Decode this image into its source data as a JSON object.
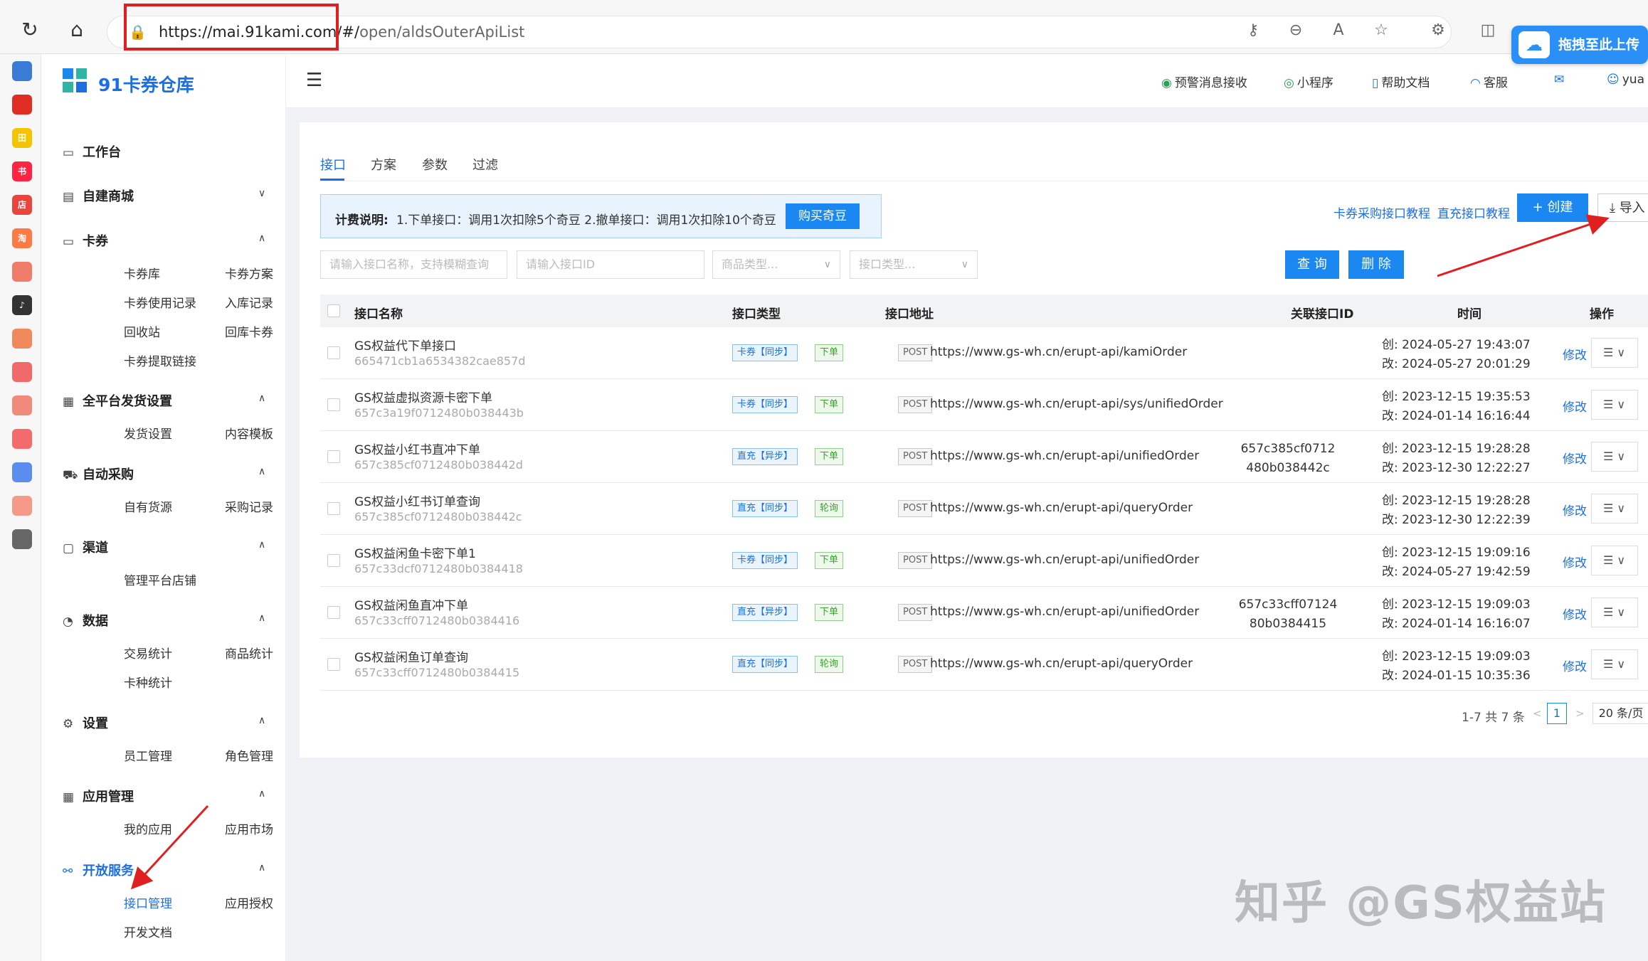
{
  "browser": {
    "url_host": "https://mai.91kami.com/#/",
    "url_path": "open/aldsOuterApiList",
    "upload_label": "拖拽至此上传",
    "icons": [
      "refresh-icon",
      "home-icon",
      "lock-icon",
      "key-icon",
      "zoom-out-icon",
      "read-aloud-icon",
      "favorite-icon",
      "extensions-icon",
      "split-view-icon"
    ]
  },
  "app_strip": {
    "icons": [
      {
        "name": "qr-app-icon",
        "color": "#3a7bd5",
        "text": ""
      },
      {
        "name": "pinduoduo-icon",
        "color": "#e02e24",
        "text": ""
      },
      {
        "name": "tianmao-icon",
        "color": "#f5c400",
        "text": "田"
      },
      {
        "name": "xiaohongshu-icon",
        "color": "#ff2442",
        "text": "书"
      },
      {
        "name": "shop-icon",
        "color": "#e8453c",
        "text": "店"
      },
      {
        "name": "taobao-icon",
        "color": "#ff7a45",
        "text": "淘"
      },
      {
        "name": "store-icon",
        "color": "#f07c6a",
        "text": ""
      },
      {
        "name": "douyin-icon",
        "color": "#333333",
        "text": "♪"
      },
      {
        "name": "app-orange-icon",
        "color": "#f08a5d",
        "text": ""
      },
      {
        "name": "thumb-icon",
        "color": "#f06a6a",
        "text": ""
      },
      {
        "name": "app-red-icon",
        "color": "#f08a7a",
        "text": ""
      },
      {
        "name": "app-red2-icon",
        "color": "#f46b6b",
        "text": ""
      },
      {
        "name": "link-app-icon",
        "color": "#5b8def",
        "text": ""
      },
      {
        "name": "app-pink-icon",
        "color": "#f59a8a",
        "text": ""
      },
      {
        "name": "app-dark-icon",
        "color": "#666666",
        "text": ""
      }
    ]
  },
  "sidebar": {
    "logo_text": "91卡券仓库",
    "groups": [
      {
        "label": "工作台",
        "icon": "monitor-icon",
        "items": []
      },
      {
        "label": "自建商城",
        "icon": "store-icon",
        "items": []
      },
      {
        "label": "卡券",
        "icon": "card-icon",
        "items": [
          "卡券库",
          "卡券方案",
          "卡券使用记录",
          "入库记录",
          "回收站",
          "回库卡券",
          "卡券提取链接"
        ]
      },
      {
        "label": "全平台发货设置",
        "icon": "grid-icon",
        "items": [
          "发货设置",
          "内容模板"
        ]
      },
      {
        "label": "自动采购",
        "icon": "cart-icon",
        "items": [
          "自有货源",
          "采购记录"
        ]
      },
      {
        "label": "渠道",
        "icon": "bag-icon",
        "items": [
          "管理平台店铺"
        ]
      },
      {
        "label": "数据",
        "icon": "chart-icon",
        "items": [
          "交易统计",
          "商品统计",
          "卡种统计"
        ]
      },
      {
        "label": "设置",
        "icon": "gear-icon",
        "items": [
          "员工管理",
          "角色管理"
        ]
      },
      {
        "label": "应用管理",
        "icon": "apps-icon",
        "items": [
          "我的应用",
          "应用市场"
        ]
      },
      {
        "label": "开放服务",
        "icon": "link-icon",
        "items": [
          "接口管理",
          "应用授权",
          "开发文档"
        ]
      }
    ]
  },
  "header": {
    "items": [
      {
        "label": "预警消息接收",
        "icon": "wechat-icon"
      },
      {
        "label": "小程序",
        "icon": "miniapp-icon"
      },
      {
        "label": "帮助文档",
        "icon": "doc-icon"
      },
      {
        "label": "客服",
        "icon": "headset-icon"
      },
      {
        "label": "",
        "icon": "mail-icon"
      },
      {
        "label": "yua",
        "icon": "user-icon"
      }
    ]
  },
  "main": {
    "tabs": [
      "接口",
      "方案",
      "参数",
      "过滤"
    ],
    "billing_label": "计费说明:",
    "billing_text": "1.下单接口：调用1次扣除5个奇豆  2.撤单接口：调用1次扣除10个奇豆",
    "buy_label": "购买奇豆",
    "link1": "卡券采购接口教程",
    "link2": "直充接口教程",
    "create_label": "+ 创建",
    "import_label": "导入",
    "filters": {
      "name_placeholder": "请输入接口名称，支持模糊查询",
      "id_placeholder": "请输入接口ID",
      "goods_type": "商品类型...",
      "api_type": "接口类型..."
    },
    "query_label": "查 询",
    "delete_label": "删 除",
    "columns": [
      "接口名称",
      "接口类型",
      "接口地址",
      "关联接口ID",
      "时间",
      "操作"
    ],
    "rows": [
      {
        "name": "GS权益代下单接口",
        "id": "665471cb1a6534382cae857d",
        "type": "卡券【同步】",
        "action": "下单",
        "method": "POST",
        "url": "https://www.gs-wh.cn/erupt-api/kamiOrder",
        "rel": "",
        "created": "创:  2024-05-27 19:43:07",
        "modified": "改:  2024-05-27 20:01:29"
      },
      {
        "name": "GS权益虚拟资源卡密下单",
        "id": "657c3a19f0712480b038443b",
        "type": "卡券【同步】",
        "action": "下单",
        "method": "POST",
        "url": "https://www.gs-wh.cn/erupt-api/sys/unifiedOrder",
        "rel": "",
        "created": "创:  2023-12-15 19:35:53",
        "modified": "改:  2024-01-14 16:16:44"
      },
      {
        "name": "GS权益小红书直冲下单",
        "id": "657c385cf0712480b038442d",
        "type": "直充【异步】",
        "action": "下单",
        "method": "POST",
        "url": "https://www.gs-wh.cn/erupt-api/unifiedOrder",
        "rel": "657c385cf0712480b038442c",
        "created": "创:  2023-12-15 19:28:28",
        "modified": "改:  2023-12-30 12:22:27"
      },
      {
        "name": "GS权益小红书订单查询",
        "id": "657c385cf0712480b038442c",
        "type": "直充【同步】",
        "action": "轮询",
        "method": "POST",
        "url": "https://www.gs-wh.cn/erupt-api/queryOrder",
        "rel": "",
        "created": "创:  2023-12-15 19:28:28",
        "modified": "改:  2023-12-30 12:22:39"
      },
      {
        "name": "GS权益闲鱼卡密下单1",
        "id": "657c33dcf0712480b0384418",
        "type": "卡券【同步】",
        "action": "下单",
        "method": "POST",
        "url": "https://www.gs-wh.cn/erupt-api/unifiedOrder",
        "rel": "",
        "created": "创:  2023-12-15 19:09:16",
        "modified": "改:  2024-05-27 19:42:59"
      },
      {
        "name": "GS权益闲鱼直冲下单",
        "id": "657c33cff0712480b0384416",
        "type": "直充【异步】",
        "action": "下单",
        "method": "POST",
        "url": "https://www.gs-wh.cn/erupt-api/unifiedOrder",
        "rel": "657c33cff0712480b0384415",
        "created": "创:  2023-12-15 19:09:03",
        "modified": "改:  2024-01-14 16:16:07"
      },
      {
        "name": "GS权益闲鱼订单查询",
        "id": "657c33cff0712480b0384415",
        "type": "直充【同步】",
        "action": "轮询",
        "method": "POST",
        "url": "https://www.gs-wh.cn/erupt-api/queryOrder",
        "rel": "",
        "created": "创:  2023-12-15 19:09:03",
        "modified": "改:  2024-01-15 10:35:36"
      }
    ],
    "edit_label": "修改",
    "more_label": "☰  ∨",
    "pagination": {
      "total": "1-7 共 7 条",
      "page": "1",
      "size": "20 条/页"
    }
  },
  "watermark": "知乎 @GS权益站",
  "colors": {
    "primary": "#1b88f2",
    "link": "#1b6fe0",
    "annotation": "#e02020"
  }
}
